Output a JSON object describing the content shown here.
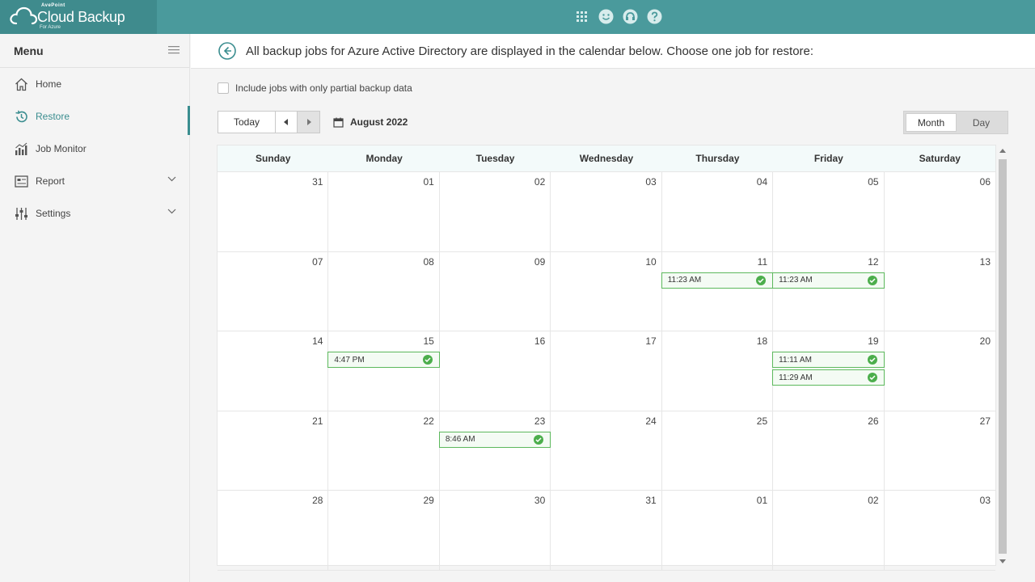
{
  "brand": {
    "company": "AvePoint",
    "product": "Cloud Backup",
    "edition": "For Azure"
  },
  "colors": {
    "header": "#4a9a9c",
    "accent": "#3a8d8f",
    "success": "#4cae4c"
  },
  "header_icons": [
    "apps-grid-icon",
    "feedback-smile-icon",
    "support-icon",
    "help-icon"
  ],
  "sidebar": {
    "title": "Menu",
    "items": [
      {
        "label": "Home",
        "icon": "home-icon"
      },
      {
        "label": "Restore",
        "icon": "restore-icon",
        "active": true
      },
      {
        "label": "Job Monitor",
        "icon": "job-monitor-icon"
      },
      {
        "label": "Report",
        "icon": "report-icon",
        "expandable": true
      },
      {
        "label": "Settings",
        "icon": "settings-icon",
        "expandable": true
      }
    ]
  },
  "main": {
    "message": "All backup jobs for Azure Active Directory are displayed in the calendar below. Choose one job for restore:",
    "partial_checkbox_label": "Include jobs with only partial backup data",
    "partial_checked": false,
    "today_label": "Today",
    "current_month": "August 2022",
    "views": [
      "Month",
      "Day"
    ],
    "active_view": "Month"
  },
  "calendar": {
    "weekdays": [
      "Sunday",
      "Monday",
      "Tuesday",
      "Wednesday",
      "Thursday",
      "Friday",
      "Saturday"
    ],
    "days": [
      {
        "d": "31",
        "events": []
      },
      {
        "d": "01",
        "events": []
      },
      {
        "d": "02",
        "events": []
      },
      {
        "d": "03",
        "events": []
      },
      {
        "d": "04",
        "events": []
      },
      {
        "d": "05",
        "events": []
      },
      {
        "d": "06",
        "events": []
      },
      {
        "d": "07",
        "events": []
      },
      {
        "d": "08",
        "events": []
      },
      {
        "d": "09",
        "events": []
      },
      {
        "d": "10",
        "events": []
      },
      {
        "d": "11",
        "events": [
          "11:23 AM"
        ]
      },
      {
        "d": "12",
        "events": [
          "11:23 AM"
        ]
      },
      {
        "d": "13",
        "events": []
      },
      {
        "d": "14",
        "events": []
      },
      {
        "d": "15",
        "events": [
          "4:47 PM"
        ]
      },
      {
        "d": "16",
        "events": []
      },
      {
        "d": "17",
        "events": []
      },
      {
        "d": "18",
        "events": []
      },
      {
        "d": "19",
        "events": [
          "11:11 AM",
          "11:29 AM"
        ]
      },
      {
        "d": "20",
        "events": []
      },
      {
        "d": "21",
        "events": []
      },
      {
        "d": "22",
        "events": []
      },
      {
        "d": "23",
        "events": [
          "8:46 AM"
        ]
      },
      {
        "d": "24",
        "events": []
      },
      {
        "d": "25",
        "events": []
      },
      {
        "d": "26",
        "events": []
      },
      {
        "d": "27",
        "events": []
      },
      {
        "d": "28",
        "events": []
      },
      {
        "d": "29",
        "events": []
      },
      {
        "d": "30",
        "events": []
      },
      {
        "d": "31",
        "events": []
      },
      {
        "d": "01",
        "events": []
      },
      {
        "d": "02",
        "events": []
      },
      {
        "d": "03",
        "events": []
      }
    ]
  }
}
